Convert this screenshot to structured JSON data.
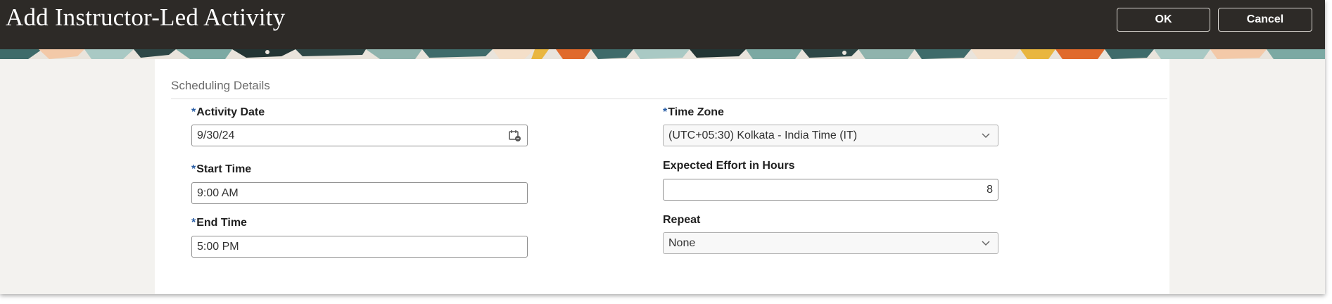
{
  "header": {
    "title": "Add Instructor-Led Activity",
    "ok_label": "OK",
    "cancel_label": "Cancel"
  },
  "section": {
    "title": "Scheduling Details"
  },
  "fields": {
    "activity_date": {
      "required": "*",
      "label": "Activity Date",
      "value": "9/30/24",
      "icon": "calendar-icon"
    },
    "start_time": {
      "required": "*",
      "label": "Start Time",
      "value": "9:00 AM"
    },
    "end_time": {
      "required": "*",
      "label": "End Time",
      "value": "5:00 PM"
    },
    "time_zone": {
      "required": "*",
      "label": "Time Zone",
      "value": "(UTC+05:30) Kolkata - India Time (IT)",
      "icon": "chevron-down-icon"
    },
    "expected_effort": {
      "label": "Expected Effort in Hours",
      "value": "8"
    },
    "repeat": {
      "label": "Repeat",
      "value": "None",
      "icon": "chevron-down-icon"
    }
  },
  "colors": {
    "header_bg": "#2d2a27",
    "required_marker": "#2b5fa6",
    "banner_teal": "#3f6b6a",
    "banner_orange": "#e06a2c"
  }
}
